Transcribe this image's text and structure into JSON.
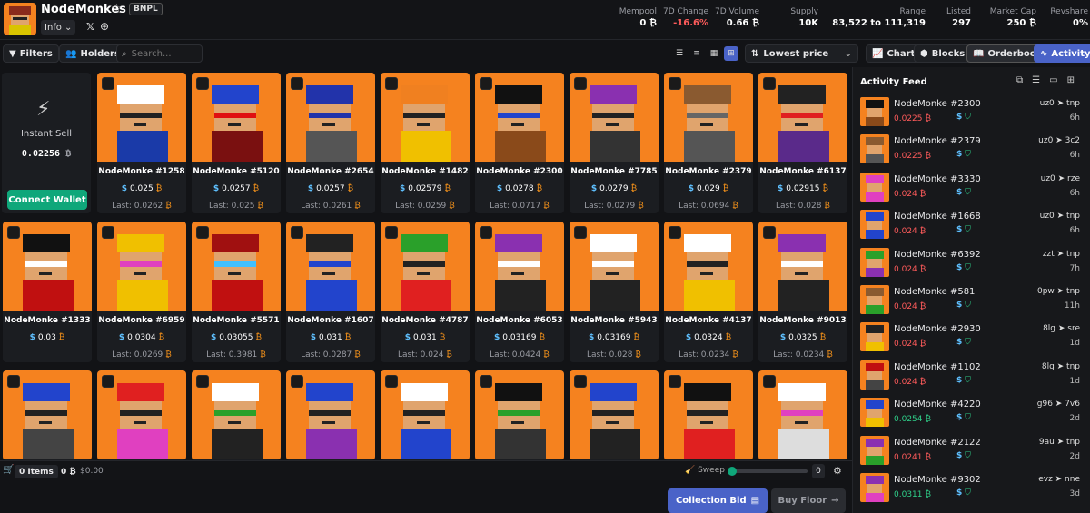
{
  "header": {
    "name": "NodeMonkes",
    "badge": "BNPL",
    "info_label": "Info",
    "stats": [
      {
        "label": "Mempool",
        "value": "0 ₿",
        "color": ""
      },
      {
        "label": "7D Change",
        "value": "-16.6%",
        "color": "red"
      },
      {
        "label": "7D Volume",
        "value": "0.66 ₿",
        "color": ""
      },
      {
        "label": "Supply",
        "value": "10K",
        "color": ""
      },
      {
        "label": "Range",
        "value": "83,522 to 111,319",
        "color": ""
      },
      {
        "label": "Listed",
        "value": "297",
        "color": ""
      },
      {
        "label": "Market Cap",
        "value": "250 ₿",
        "color": ""
      },
      {
        "label": "Revshare",
        "value": "0%",
        "color": ""
      }
    ]
  },
  "toolbar": {
    "filters": "Filters",
    "holders": "Holders",
    "search_placeholder": "Search...",
    "sort": "Lowest price",
    "chart": "Chart",
    "blocks": "Blocks",
    "orderbook": "Orderbook",
    "activity": "Activity"
  },
  "instant_sell": {
    "title": "Instant Sell",
    "price": "0.02256",
    "connect": "Connect Wallet"
  },
  "cards": [
    {
      "name": "NodeMonke #1258",
      "price": "0.025",
      "last": "Last: 0.0262",
      "hat": "#ffffff",
      "body": "#1a3aa8",
      "eyes": "#222",
      "accent": "#ffffff"
    },
    {
      "name": "NodeMonke #5120",
      "price": "0.0257",
      "last": "Last: 0.025",
      "hat": "#2244cc",
      "body": "#7a1010",
      "eyes": "#e01010",
      "accent": "#b01818"
    },
    {
      "name": "NodeMonke #2654",
      "price": "0.0257",
      "last": "Last: 0.0261",
      "hat": "#2233aa",
      "body": "#555555",
      "eyes": "#2233aa",
      "accent": "#2233aa"
    },
    {
      "name": "NodeMonke #1482",
      "price": "0.02579",
      "last": "Last: 0.0259",
      "hat": "#f08020",
      "body": "#f0c000",
      "eyes": "#222",
      "accent": "#f0c000"
    },
    {
      "name": "NodeMonke #2300",
      "price": "0.0278",
      "last": "Last: 0.0717",
      "hat": "#111111",
      "body": "#8a4a1a",
      "eyes": "#2244cc",
      "accent": "#6a3a12"
    },
    {
      "name": "NodeMonke #7785",
      "price": "0.0279",
      "last": "Last: 0.0279",
      "hat": "#8a30b0",
      "body": "#333333",
      "eyes": "#222",
      "accent": "#333333"
    },
    {
      "name": "NodeMonke #2379",
      "price": "0.029",
      "last": "Last: 0.0694",
      "hat": "#8a5a30",
      "body": "#555555",
      "eyes": "#666",
      "accent": "#e0a46d"
    },
    {
      "name": "NodeMonke #6137",
      "price": "0.02915",
      "last": "Last: 0.028",
      "hat": "#222222",
      "body": "#5a2a8a",
      "eyes": "#e02020",
      "accent": "#7a30b0"
    },
    {
      "name": "NodeMonke #1333",
      "price": "0.03",
      "last": "",
      "hat": "#111111",
      "body": "#c01010",
      "eyes": "#ffffff",
      "accent": "#f0c000"
    },
    {
      "name": "NodeMonke #6959",
      "price": "0.0304",
      "last": "Last: 0.0269",
      "hat": "#f0c000",
      "body": "#f0c000",
      "eyes": "#e040c0",
      "accent": "#f0c000"
    },
    {
      "name": "NodeMonke #5571",
      "price": "0.03055",
      "last": "Last: 0.3981",
      "hat": "#a01010",
      "body": "#c01010",
      "eyes": "#40c0ff",
      "accent": "#c01010"
    },
    {
      "name": "NodeMonke #1607",
      "price": "0.031",
      "last": "Last: 0.0287",
      "hat": "#222222",
      "body": "#2244cc",
      "eyes": "#2244cc",
      "accent": "#2244cc"
    },
    {
      "name": "NodeMonke #4787",
      "price": "0.031",
      "last": "Last: 0.024",
      "hat": "#2aa02a",
      "body": "#e02020",
      "eyes": "#222",
      "accent": "#2aa02a"
    },
    {
      "name": "NodeMonke #6053",
      "price": "0.03169",
      "last": "Last: 0.0424",
      "hat": "#8a30b0",
      "body": "#222222",
      "eyes": "#ffffff",
      "accent": "#aaaaaa"
    },
    {
      "name": "NodeMonke #5943",
      "price": "0.03169",
      "last": "Last: 0.028",
      "hat": "#ffffff",
      "body": "#222222",
      "eyes": "#ffffff",
      "accent": "#aaaaaa"
    },
    {
      "name": "NodeMonke #4137",
      "price": "0.0324",
      "last": "Last: 0.0234",
      "hat": "#ffffff",
      "body": "#f0c000",
      "eyes": "#222",
      "accent": "#f0c000"
    },
    {
      "name": "NodeMonke #9013",
      "price": "0.0325",
      "last": "Last: 0.0234",
      "hat": "#8a30b0",
      "body": "#222222",
      "eyes": "#ffffff",
      "accent": "#aaaaaa"
    },
    {
      "name": "",
      "price": "",
      "last": "",
      "hat": "#2244cc",
      "body": "#444444",
      "eyes": "#222",
      "accent": "#444444"
    },
    {
      "name": "",
      "price": "",
      "last": "",
      "hat": "#e02020",
      "body": "#e040c0",
      "eyes": "#222",
      "accent": "#e040c0"
    },
    {
      "name": "",
      "price": "",
      "last": "",
      "hat": "#ffffff",
      "body": "#222222",
      "eyes": "#2aa02a",
      "accent": "#ffffff"
    },
    {
      "name": "",
      "price": "",
      "last": "",
      "hat": "#2244cc",
      "body": "#8a30b0",
      "eyes": "#222",
      "accent": "#ffffff"
    },
    {
      "name": "",
      "price": "",
      "last": "",
      "hat": "#ffffff",
      "body": "#2244cc",
      "eyes": "#222",
      "accent": "#111111"
    },
    {
      "name": "",
      "price": "",
      "last": "",
      "hat": "#111111",
      "body": "#333333",
      "eyes": "#2aa02a",
      "accent": "#aaaaaa"
    },
    {
      "name": "",
      "price": "",
      "last": "",
      "hat": "#2244cc",
      "body": "#222222",
      "eyes": "#222",
      "accent": "#aaaaaa"
    },
    {
      "name": "",
      "price": "",
      "last": "",
      "hat": "#111111",
      "body": "#e02020",
      "eyes": "#222",
      "accent": "#e02020"
    },
    {
      "name": "",
      "price": "",
      "last": "",
      "hat": "#ffffff",
      "body": "#dddddd",
      "eyes": "#e040c0",
      "accent": "#dddddd"
    }
  ],
  "bottom": {
    "items": "0 Items",
    "amount": "0 ₿",
    "usd": "$0.00",
    "sweep": "Sweep",
    "sweep_value": "0",
    "collection_bid": "Collection Bid",
    "buy_floor": "Buy Floor"
  },
  "activity": {
    "title": "Activity Feed",
    "rows": [
      {
        "name": "NodeMonke #2300",
        "price": "0.0225 ₿",
        "green": false,
        "route": "uz0 ➤ tnp",
        "time": "6h",
        "hat": "#111111",
        "body": "#8a4a1a"
      },
      {
        "name": "NodeMonke #2379",
        "price": "0.0225 ₿",
        "green": false,
        "route": "uz0 ➤ 3c2",
        "time": "6h",
        "hat": "#8a5a30",
        "body": "#555555"
      },
      {
        "name": "NodeMonke #3330",
        "price": "0.024 ₿",
        "green": false,
        "route": "uz0 ➤ rze",
        "time": "6h",
        "hat": "#e040c0",
        "body": "#e040c0"
      },
      {
        "name": "NodeMonke #1668",
        "price": "0.024 ₿",
        "green": false,
        "route": "uz0 ➤ tnp",
        "time": "6h",
        "hat": "#2244cc",
        "body": "#2244cc"
      },
      {
        "name": "NodeMonke #6392",
        "price": "0.024 ₿",
        "green": false,
        "route": "zzt ➤ tnp",
        "time": "7h",
        "hat": "#2aa02a",
        "body": "#8a30b0"
      },
      {
        "name": "NodeMonke #581",
        "price": "0.024 ₿",
        "green": false,
        "route": "0pw ➤ tnp",
        "time": "11h",
        "hat": "#8a5a30",
        "body": "#2aa02a"
      },
      {
        "name": "NodeMonke #2930",
        "price": "0.024 ₿",
        "green": false,
        "route": "8lg ➤ sre",
        "time": "1d",
        "hat": "#222222",
        "body": "#f0c000"
      },
      {
        "name": "NodeMonke #1102",
        "price": "0.024 ₿",
        "green": false,
        "route": "8lg ➤ tnp",
        "time": "1d",
        "hat": "#c01010",
        "body": "#444444"
      },
      {
        "name": "NodeMonke #4220",
        "price": "0.0254 ₿",
        "green": true,
        "route": "g96 ➤ 7v6",
        "time": "2d",
        "hat": "#2244cc",
        "body": "#f0c000"
      },
      {
        "name": "NodeMonke #2122",
        "price": "0.0241 ₿",
        "green": false,
        "route": "9au ➤ tnp",
        "time": "2d",
        "hat": "#8a30b0",
        "body": "#2aa02a"
      },
      {
        "name": "NodeMonke #9302",
        "price": "0.0311 ₿",
        "green": true,
        "route": "evz ➤ nne",
        "time": "3d",
        "hat": "#8a30b0",
        "body": "#e040c0"
      }
    ]
  }
}
